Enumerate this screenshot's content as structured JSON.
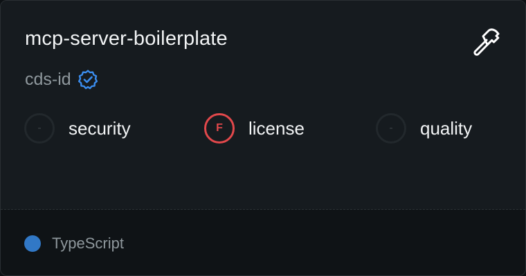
{
  "card": {
    "title": "mcp-server-boilerplate",
    "owner": "cds-id",
    "owner_verified": true,
    "tool_icon": "hammer-icon"
  },
  "scores": [
    {
      "grade": "-",
      "label": "security",
      "status": "none"
    },
    {
      "grade": "F",
      "label": "license",
      "status": "fail"
    },
    {
      "grade": "-",
      "label": "quality",
      "status": "none"
    }
  ],
  "language": {
    "name": "TypeScript",
    "color": "#3178c6"
  },
  "colors": {
    "verified": "#3b8ef0",
    "fail": "#e2484b"
  }
}
